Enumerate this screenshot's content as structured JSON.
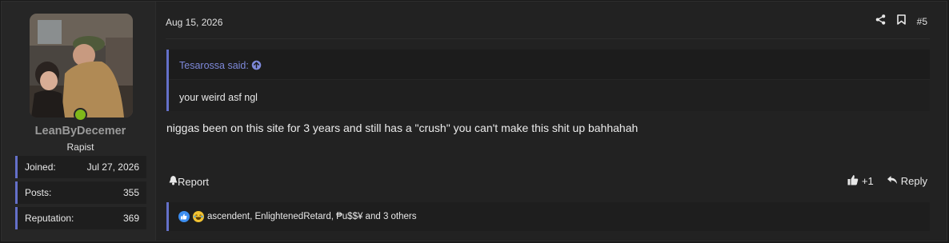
{
  "user": {
    "username": "LeanByDecemer",
    "title": "Rapist",
    "stats": [
      {
        "label": "Joined:",
        "value": "Jul 27, 2026"
      },
      {
        "label": "Posts:",
        "value": "355"
      },
      {
        "label": "Reputation:",
        "value": "369"
      }
    ]
  },
  "post": {
    "date": "Aug 15, 2026",
    "number": "#5",
    "quote": {
      "author": "Tesarossa said:",
      "text": "your weird asf ngl"
    },
    "message": "niggas been on this site for 3 years and still has a \"crush\" you can't make this shit up bahhahah",
    "report_label": "Report",
    "like_count": "+1",
    "reply_label": "Reply",
    "reactions_text": "ascendent, EnlightenedRetard, ₱u$$¥ and 3 others"
  },
  "colors": {
    "accent": "#6470c9",
    "link": "#7d88d9",
    "online": "#7fb81a",
    "like": "#3c8ef0",
    "laugh": "#f1c232"
  }
}
